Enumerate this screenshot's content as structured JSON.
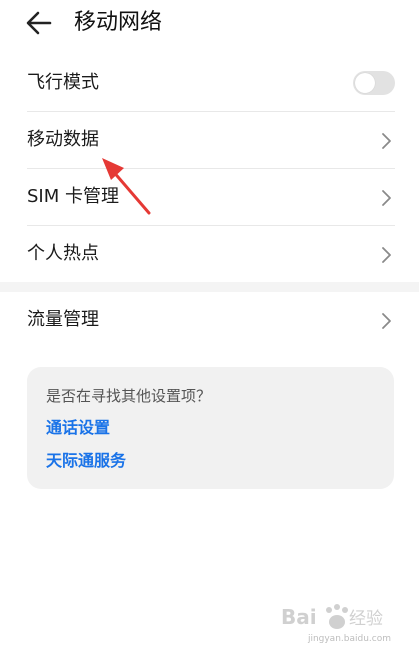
{
  "header": {
    "title": "移动网络",
    "back_icon": "arrow-left-icon"
  },
  "settings": {
    "airplane_mode": {
      "label": "飞行模式",
      "enabled": false
    },
    "items": [
      {
        "label": "移动数据",
        "icon": "chevron-right-icon"
      },
      {
        "label": "SIM 卡管理",
        "icon": "chevron-right-icon"
      },
      {
        "label": "个人热点",
        "icon": "chevron-right-icon"
      }
    ],
    "data_usage": {
      "label": "流量管理",
      "icon": "chevron-right-icon"
    }
  },
  "suggestion_card": {
    "question": "是否在寻找其他设置项？",
    "links": [
      "通话设置",
      "天际通服务"
    ]
  },
  "watermark": {
    "logo_text": "Bai 经验",
    "url": "jingyan.baidu.com"
  },
  "colors": {
    "link": "#1a73e8",
    "annotation_arrow": "#e53935",
    "card_bg": "#f1f1f1",
    "toggle_off": "#e2e2e2"
  }
}
